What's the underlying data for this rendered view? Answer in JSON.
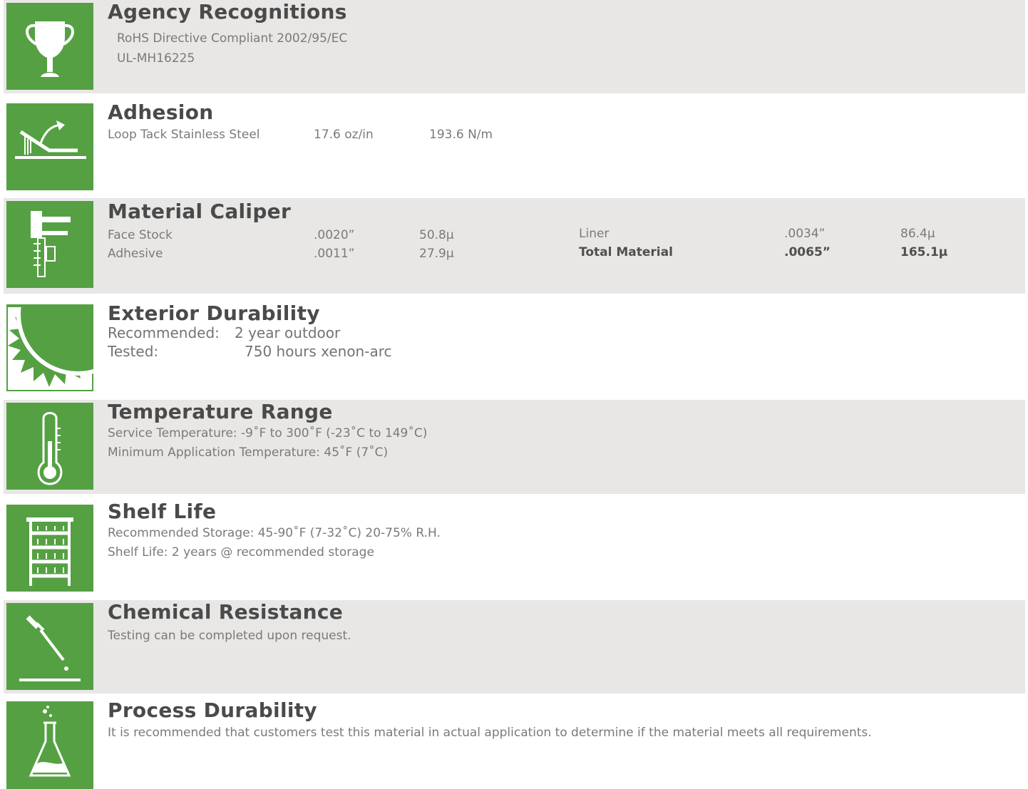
{
  "sections": {
    "agency": {
      "title": "Agency Recognitions",
      "lines": [
        "RoHS Directive Compliant 2002/95/EC",
        "UL-MH16225"
      ]
    },
    "adhesion": {
      "title": "Adhesion",
      "test": "Loop Tack Stainless Steel",
      "imperial": "17.6 oz/in",
      "metric": "193.6 N/m"
    },
    "caliper": {
      "title": "Material Caliper",
      "rows": [
        {
          "label": "Face Stock",
          "in": ".0020”",
          "um": "50.8μ"
        },
        {
          "label": "Adhesive",
          "in": ".0011”",
          "um": "27.9μ"
        },
        {
          "label": "Liner",
          "in": ".0034”",
          "um": "86.4μ"
        },
        {
          "label": "Total Material",
          "in": ".0065”",
          "um": "165.1μ"
        }
      ]
    },
    "exterior": {
      "title": "Exterior Durability",
      "recommended_label": "Recommended:",
      "recommended_value": "2 year outdoor",
      "tested_label": "Tested:",
      "tested_value": "750 hours xenon-arc"
    },
    "temperature": {
      "title": "Temperature Range",
      "lines": [
        "Service Temperature: -9˚F to 300˚F (-23˚C to 149˚C)",
        "Minimum Application Temperature: 45˚F (7˚C)"
      ]
    },
    "shelf": {
      "title": "Shelf Life",
      "lines": [
        "Recommended Storage: 45-90˚F (7-32˚C) 20-75% R.H.",
        "Shelf Life: 2 years @ recommended storage"
      ]
    },
    "chemical": {
      "title": "Chemical Resistance",
      "line": "Testing can be completed upon request."
    },
    "process": {
      "title": "Process Durability",
      "line": "It is recommended that customers test this material in actual application to determine if the material meets all requirements."
    }
  },
  "icons": [
    "trophy-icon",
    "adhesion-peel-icon",
    "caliper-icon",
    "sun-icon",
    "thermometer-icon",
    "shelf-icon",
    "dropper-icon",
    "flask-icon"
  ],
  "colors": {
    "icon_green": "#55a043",
    "band_gray": "#e8e7e6",
    "title": "#4a4a4a",
    "text": "#7a7a7a"
  }
}
